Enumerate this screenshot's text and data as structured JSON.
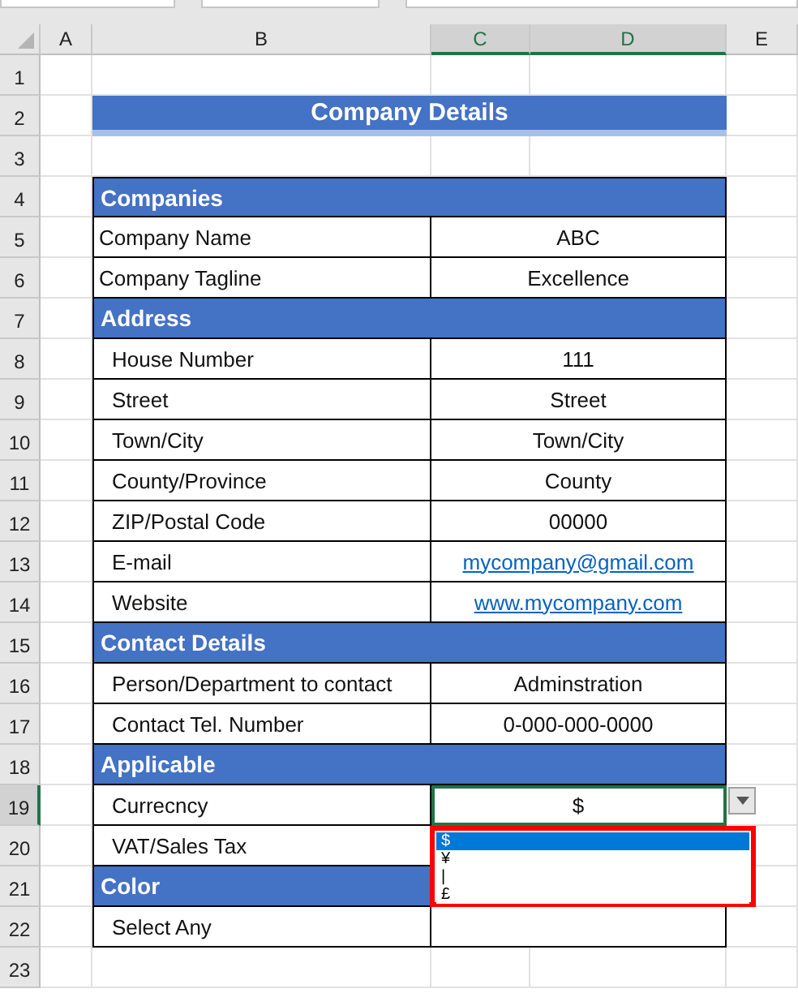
{
  "columns": [
    {
      "label": "A",
      "selected": false
    },
    {
      "label": "B",
      "selected": false
    },
    {
      "label": "C",
      "selected": true
    },
    {
      "label": "D",
      "selected": true
    },
    {
      "label": "E",
      "selected": false
    }
  ],
  "rows": [
    {
      "number": "1",
      "selected": false,
      "kind": "blank"
    },
    {
      "number": "2",
      "selected": false,
      "kind": "title",
      "title": "Company Details"
    },
    {
      "number": "3",
      "selected": false,
      "kind": "blank"
    },
    {
      "number": "4",
      "selected": false,
      "kind": "section",
      "text": "Companies"
    },
    {
      "number": "5",
      "selected": false,
      "kind": "field",
      "label": "Company Name",
      "indent": false,
      "value": "ABC",
      "link": false,
      "active": false
    },
    {
      "number": "6",
      "selected": false,
      "kind": "field",
      "label": "Company Tagline",
      "indent": false,
      "value": "Excellence",
      "link": false,
      "active": false
    },
    {
      "number": "7",
      "selected": false,
      "kind": "section",
      "text": "Address"
    },
    {
      "number": "8",
      "selected": false,
      "kind": "field",
      "label": "House Number",
      "indent": true,
      "value": "111",
      "link": false,
      "active": false
    },
    {
      "number": "9",
      "selected": false,
      "kind": "field",
      "label": "Street",
      "indent": true,
      "value": "Street",
      "link": false,
      "active": false
    },
    {
      "number": "10",
      "selected": false,
      "kind": "field",
      "label": "Town/City",
      "indent": true,
      "value": "Town/City",
      "link": false,
      "active": false
    },
    {
      "number": "11",
      "selected": false,
      "kind": "field",
      "label": "County/Province",
      "indent": true,
      "value": "County",
      "link": false,
      "active": false
    },
    {
      "number": "12",
      "selected": false,
      "kind": "field",
      "label": "ZIP/Postal Code",
      "indent": true,
      "value": "00000",
      "link": false,
      "active": false
    },
    {
      "number": "13",
      "selected": false,
      "kind": "field",
      "label": "E-mail",
      "indent": true,
      "value": "mycompany@gmail.com",
      "link": true,
      "active": false
    },
    {
      "number": "14",
      "selected": false,
      "kind": "field",
      "label": "Website",
      "indent": true,
      "value": "www.mycompany.com",
      "link": true,
      "active": false
    },
    {
      "number": "15",
      "selected": false,
      "kind": "section",
      "text": "Contact Details"
    },
    {
      "number": "16",
      "selected": false,
      "kind": "field",
      "label": "Person/Department to contact",
      "indent": true,
      "value": "Adminstration",
      "link": false,
      "active": false
    },
    {
      "number": "17",
      "selected": false,
      "kind": "field",
      "label": "Contact Tel. Number",
      "indent": true,
      "value": "0-000-000-0000",
      "link": false,
      "active": false
    },
    {
      "number": "18",
      "selected": false,
      "kind": "section",
      "text": "Applicable"
    },
    {
      "number": "19",
      "selected": true,
      "kind": "field",
      "label": "Currecncy",
      "indent": true,
      "value": "$",
      "link": false,
      "active": true,
      "dropdown": [
        {
          "text": "$",
          "selected": true
        },
        {
          "text": "¥",
          "selected": false
        },
        {
          "text": "|",
          "selected": false
        },
        {
          "text": "£",
          "selected": false
        }
      ]
    },
    {
      "number": "20",
      "selected": false,
      "kind": "field",
      "label": "VAT/Sales Tax",
      "indent": true,
      "active": false
    },
    {
      "number": "21",
      "selected": false,
      "kind": "section",
      "text": "Color"
    },
    {
      "number": "22",
      "selected": false,
      "kind": "field",
      "label": "Select Any",
      "indent": true,
      "active": false
    },
    {
      "number": "23",
      "selected": false,
      "kind": "blank"
    }
  ]
}
